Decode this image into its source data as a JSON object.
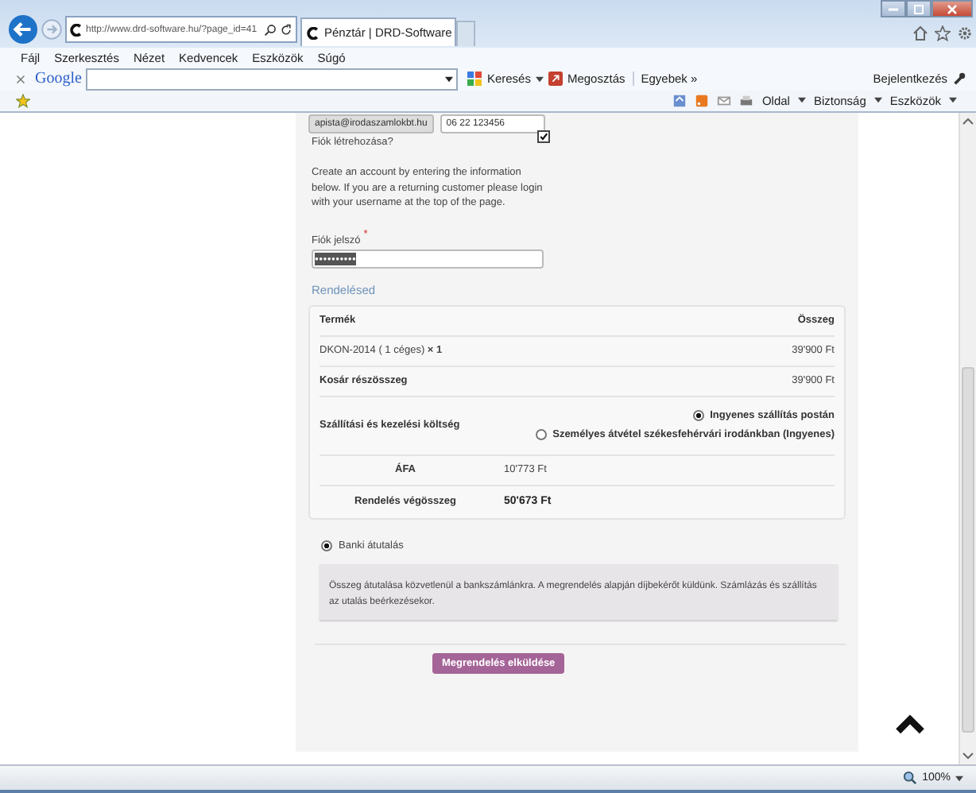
{
  "browser": {
    "address": "http://www.drd-software.hu/?page_id=41",
    "tab_title": "Pénztár | DRD-Software",
    "menu": [
      "Fájl",
      "Szerkesztés",
      "Nézet",
      "Kedvencek",
      "Eszközök",
      "Súgó"
    ],
    "google_toolbar": {
      "logo": "Google",
      "search_button": "Keresés",
      "share_button": "Megosztás",
      "more_button": "Egyebek »",
      "sign_in": "Bejelentkezés"
    },
    "command_bar": [
      "Oldal",
      "Biztonság",
      "Eszközök"
    ]
  },
  "form": {
    "email_value": "apista@irodaszamlokbt.hu",
    "phone_value": "06 22 123456",
    "create_account": {
      "label": "Fiók létrehozása?",
      "checked": true
    },
    "info": "Create an account by entering the information below. If you are a returning customer please login with your username at the top of the page.",
    "password": {
      "label": "Fiók jelszó",
      "required_mark": "*",
      "value": "●●●●●●●●●●"
    }
  },
  "order": {
    "heading": "Rendelésed",
    "columns": [
      "Termék",
      "Összeg"
    ],
    "item": {
      "name": "DKON-2014 ( 1 céges)",
      "qty": "× 1",
      "total": "39'900 Ft"
    },
    "subtotal": {
      "label": "Kosár részösszeg",
      "value": "39'900 Ft"
    },
    "shipping": {
      "label": "Szállítási és kezelési költség",
      "options": [
        {
          "label": "Ingyenes szállítás postán",
          "selected": true
        },
        {
          "label": "Személyes átvétel székesfehérvári irodánkban (Ingyenes)",
          "selected": false
        }
      ]
    },
    "tax": {
      "label": "ÁFA",
      "value": "10'773 Ft"
    },
    "grand_total": {
      "label": "Rendelés végösszeg",
      "value": "50'673 Ft"
    }
  },
  "payment": {
    "methods": [
      {
        "label": "Banki átutalás",
        "selected": true,
        "description": "Összeg átutalása közvetlenül a bankszámlánkra. A megrendelés alapján díjbekérőt küldünk. Számlázás és szállítás az utalás beérkezésekor."
      }
    ],
    "submit": "Megrendelés elküldése"
  },
  "status_bar": {
    "zoom": "100%"
  }
}
